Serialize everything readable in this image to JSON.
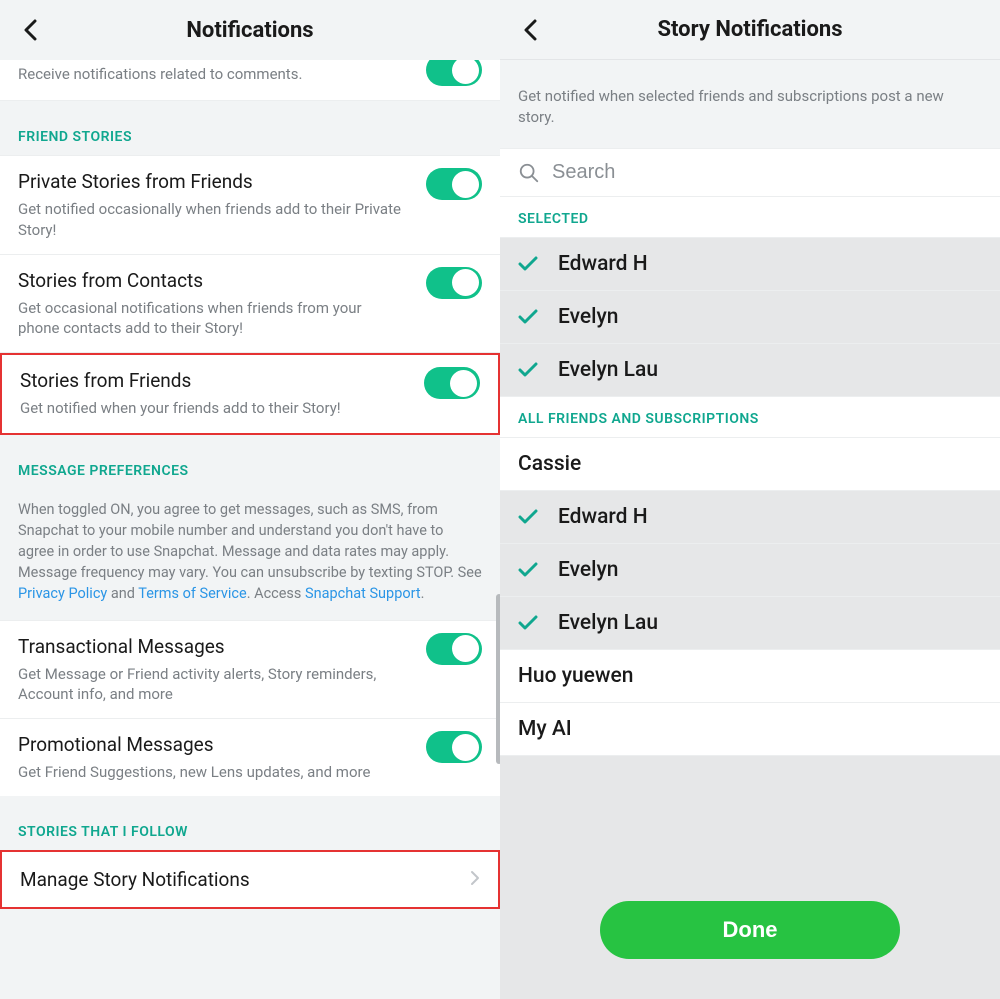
{
  "left": {
    "title": "Notifications",
    "comments_sub": "Receive notifications related to comments.",
    "friend_stories_header": "FRIEND STORIES",
    "private_stories": {
      "title": "Private Stories from Friends",
      "sub": "Get notified occasionally when friends add to their Private Story!"
    },
    "contacts_stories": {
      "title": "Stories from Contacts",
      "sub": "Get occasional notifications when friends from your phone contacts add to their Story!"
    },
    "friends_stories": {
      "title": "Stories from Friends",
      "sub": "Get notified when your friends add to their Story!"
    },
    "msg_prefs_header": "MESSAGE PREFERENCES",
    "msg_prefs_text_1": "When toggled ON, you agree to get messages, such as SMS, from Snapchat to your mobile number and understand you don't have to agree in order to use Snapchat. Message and data rates may apply. Message frequency may vary. You can unsubscribe by texting STOP. See ",
    "link_privacy": "Privacy Policy",
    "and": " and ",
    "link_tos": "Terms of Service",
    "access": ". Access ",
    "link_support": "Snapchat Support",
    "period": ".",
    "transactional": {
      "title": "Transactional Messages",
      "sub": "Get Message or Friend activity alerts, Story reminders, Account info, and more"
    },
    "promotional": {
      "title": "Promotional Messages",
      "sub": "Get Friend Suggestions, new Lens updates, and more"
    },
    "stories_follow_header": "STORIES THAT I FOLLOW",
    "manage_story": "Manage Story Notifications"
  },
  "right": {
    "title": "Story Notifications",
    "sub": "Get notified when selected friends and subscriptions post a new story.",
    "search_placeholder": "Search",
    "selected_header": "SELECTED",
    "selected": [
      {
        "name": "Edward H"
      },
      {
        "name": "Evelyn"
      },
      {
        "name": "Evelyn Lau"
      }
    ],
    "all_header": "ALL FRIENDS AND SUBSCRIPTIONS",
    "all": [
      {
        "name": "Cassie",
        "checked": false
      },
      {
        "name": "Edward H",
        "checked": true
      },
      {
        "name": "Evelyn",
        "checked": true
      },
      {
        "name": "Evelyn Lau",
        "checked": true
      },
      {
        "name": "Huo yuewen",
        "checked": false
      },
      {
        "name": "My AI",
        "checked": false
      }
    ],
    "done": "Done"
  }
}
